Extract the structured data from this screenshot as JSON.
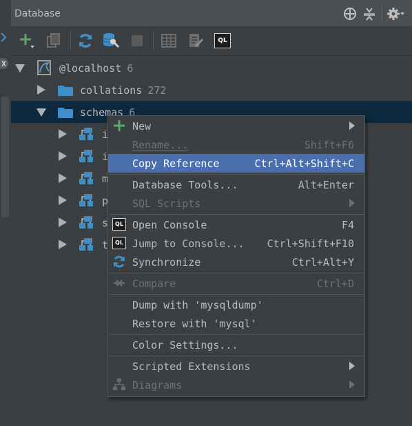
{
  "panel": {
    "title": "Database"
  },
  "tree": {
    "host": {
      "label": "@localhost",
      "count": "6"
    },
    "collations": {
      "label": "collations",
      "count": "272"
    },
    "schemas": {
      "label": "schemas",
      "count": "6"
    },
    "schema_items": [
      {
        "label": "i"
      },
      {
        "label": "i"
      },
      {
        "label": "m"
      },
      {
        "label": "p"
      },
      {
        "label": "s"
      },
      {
        "label": "t"
      }
    ]
  },
  "toolbar": {
    "buttons": [
      "add-icon",
      "copy-icon",
      "refresh-icon",
      "datasource-properties-icon",
      "stop-icon",
      "table-view-icon",
      "edit-icon",
      "console-icon"
    ],
    "console_badge": "QL"
  },
  "context_menu": {
    "new": {
      "label": "New"
    },
    "rename": {
      "label": "Rename...",
      "shortcut": "Shift+F6"
    },
    "copy_reference": {
      "label": "Copy Reference",
      "shortcut": "Ctrl+Alt+Shift+C"
    },
    "database_tools": {
      "label": "Database Tools...",
      "shortcut": "Alt+Enter"
    },
    "sql_scripts": {
      "label": "SQL Scripts"
    },
    "open_console": {
      "label": "Open Console",
      "shortcut": "F4"
    },
    "jump_to_console": {
      "label": "Jump to Console...",
      "shortcut": "Ctrl+Shift+F10"
    },
    "synchronize": {
      "label": "Synchronize",
      "shortcut": "Ctrl+Alt+Y"
    },
    "compare": {
      "label": "Compare",
      "shortcut": "Ctrl+D"
    },
    "dump": {
      "label": "Dump with 'mysqldump'"
    },
    "restore": {
      "label": "Restore with 'mysql'"
    },
    "color_settings": {
      "label": "Color Settings..."
    },
    "scripted_extensions": {
      "label": "Scripted Extensions"
    },
    "diagrams": {
      "label": "Diagrams"
    }
  },
  "colors": {
    "background": "#3c3f41",
    "selection": "#0d293e",
    "menu_highlight": "#4b6eaf",
    "folder": "#3f8ec7",
    "add_green": "#59a869"
  }
}
